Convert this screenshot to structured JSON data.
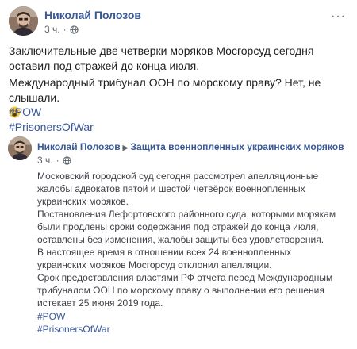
{
  "post": {
    "author": "Николай Полозов",
    "time": "3 ч.",
    "privacy_icon": "globe-icon",
    "more_icon": "more-options-icon",
    "more_label": "···",
    "paragraph1": "Заключительные две четверки моряков Мосгорсуд сегодня оставил под стражей до конца июля.",
    "paragraph2": "Международный трибунал ООН по морскому праву? Нет, не слышали.",
    "emoji": "astonished-face-emoji",
    "hashtags": [
      "#POW",
      "#PrisonersOfWar"
    ]
  },
  "shared": {
    "author": "Николай Полозов",
    "group": "Защита военнопленных украинских моряков",
    "time": "3 ч.",
    "paragraphs": [
      "Московский городской суд сегодня рассмотрел апелляционные жалобы адвокатов пятой и шестой четвёрок военнопленных украинских моряков.",
      "Постановления Лефортовского районного суда, которыми морякам были продлены сроки содержания под стражей до конца июля, оставлены без изменения, жалобы защиты без удовлетворения.",
      "В настоящее время в отношении всех 24 военнопленных украинских моряков Мосгорсуд отклонил апелляции.",
      "Срок предоставления властями РФ отчета перед Международным трибуналом ООН по морскому праву о выполнении его решения истекает 25 июня 2019 года."
    ],
    "hashtags": [
      "#POW",
      "#PrisonersOfWar"
    ]
  },
  "colors": {
    "link": "#385898",
    "text": "#1c1e21",
    "secondary": "#616770"
  }
}
